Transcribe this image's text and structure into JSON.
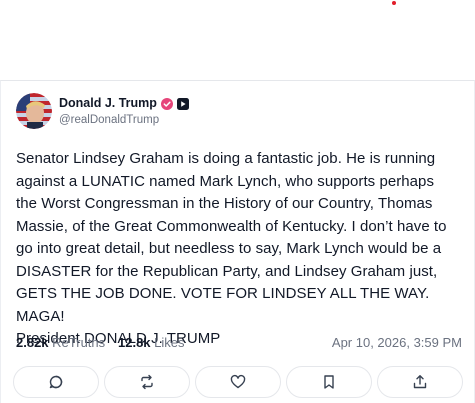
{
  "post": {
    "author": {
      "display_name": "Donald J. Trump",
      "handle": "@realDonaldTrump"
    },
    "text": "Senator Lindsey Graham is doing a fantastic job. He is running\nagainst a LUNATIC named Mark Lynch, who supports perhaps\nthe Worst Congressman in the History of our Country, Thomas\nMassie, of the Great Commonwealth of Kentucky. I don’t have to\ngo into great detail, but needless to say, Mark Lynch would be a\nDISASTER for the Republican Party, and Lindsey Graham just,\nGETS THE JOB DONE. VOTE FOR LINDSEY ALL THE WAY. MAGA!\nPresident DONALD J. TRUMP",
    "stats": {
      "retruths_count": "2.82k",
      "retruths_label": "ReTruths",
      "likes_count": "12.8k",
      "likes_label": "Likes"
    },
    "timestamp": "Apr 10, 2026, 3:59 PM"
  },
  "icons": {
    "verified": "verified-badge-icon",
    "secondary_badge": "truth-badge-icon",
    "actions": [
      "reply-icon",
      "retruth-icon",
      "like-icon",
      "bookmark-icon",
      "share-icon"
    ]
  },
  "colors": {
    "verified": "#e6457a",
    "accent_dot": "#e11d2a",
    "muted_text": "#6b7280",
    "border": "#e5e7eb"
  }
}
